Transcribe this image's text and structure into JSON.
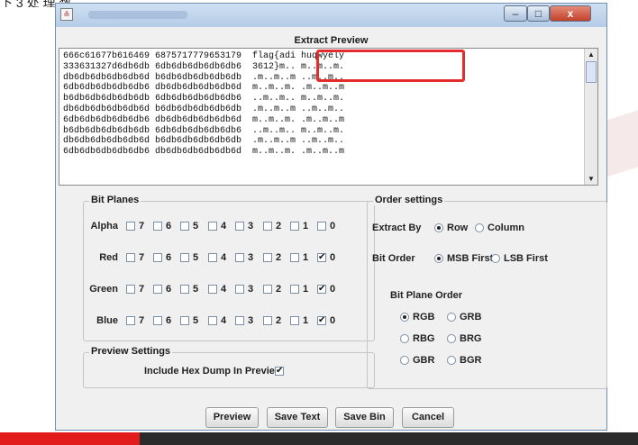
{
  "window": {
    "title_glyph": "≗",
    "buttons": {
      "minimize": "–",
      "maximize": "□",
      "close": "x"
    }
  },
  "preview": {
    "label": "Extract Preview",
    "lines": [
      "666c61677b616469 6875717779653179  flag{adi huqwyely",
      "333631327d6db6db 6db6db6db6db6db6  3612}m.. m..m..m.",
      "db6db6db6db6db6d b6db6db6db6db6db  .m..m..m ..m..m..",
      "6db6db6db6db6db6 db6db6db6db6db6d  m..m..m. .m..m..m",
      "b6db6db6db6db6db 6db6db6db6db6db6  ..m..m.. m..m..m.",
      "db6db6db6db6db6d b6db6db6db6db6db  .m..m..m ..m..m..",
      "6db6db6db6db6db6 db6db6db6db6db6d  m..m..m. .m..m..m",
      "b6db6db6db6db6db 6db6db6db6db6db6  ..m..m.. m..m..m.",
      "db6db6db6db6db6d b6db6db6db6db6db  .m..m..m ..m..m..",
      "6db6db6db6db6db6 db6db6db6db6db6d  m..m..m. .m..m..m"
    ],
    "scroll_up": "▲",
    "scroll_down": "▼"
  },
  "bit_planes": {
    "legend": "Bit Planes",
    "bits": [
      "7",
      "6",
      "5",
      "4",
      "3",
      "2",
      "1",
      "0"
    ],
    "rows": [
      {
        "name": "Alpha",
        "checked": [
          false,
          false,
          false,
          false,
          false,
          false,
          false,
          false
        ]
      },
      {
        "name": "Red",
        "checked": [
          false,
          false,
          false,
          false,
          false,
          false,
          false,
          true
        ]
      },
      {
        "name": "Green",
        "checked": [
          false,
          false,
          false,
          false,
          false,
          false,
          false,
          true
        ]
      },
      {
        "name": "Blue",
        "checked": [
          false,
          false,
          false,
          false,
          false,
          false,
          false,
          true
        ]
      }
    ]
  },
  "preview_settings": {
    "legend": "Preview Settings",
    "hex_dump_label": "Include Hex Dump In Preview",
    "hex_dump_checked": true
  },
  "order_settings": {
    "legend": "Order settings",
    "extract_by": {
      "label": "Extract By",
      "options": [
        "Row",
        "Column"
      ],
      "selected": "Row"
    },
    "bit_order": {
      "label": "Bit Order",
      "options": [
        "MSB First",
        "LSB First"
      ],
      "selected": "MSB First"
    },
    "plane_order": {
      "label": "Bit Plane Order",
      "options": [
        "RGB",
        "GRB",
        "RBG",
        "BRG",
        "GBR",
        "BGR"
      ],
      "selected": "RGB"
    }
  },
  "buttons": {
    "preview": "Preview",
    "save_text": "Save Text",
    "save_bin": "Save Bin",
    "cancel": "Cancel"
  },
  "check_mark": "✔"
}
